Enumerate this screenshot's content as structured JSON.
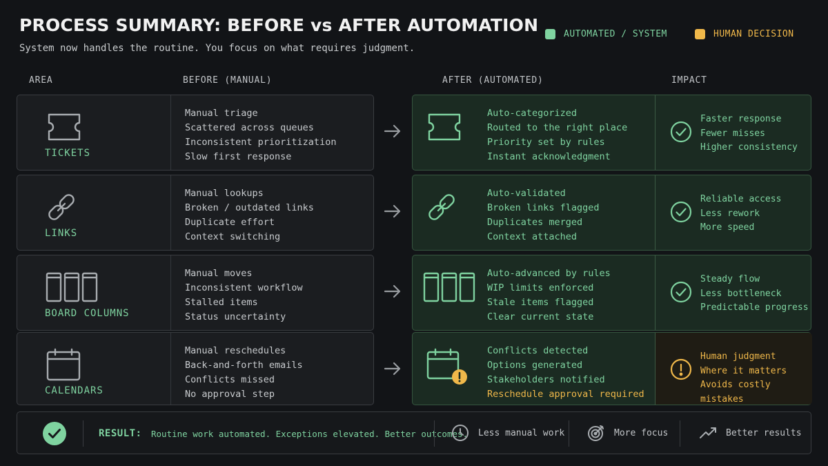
{
  "header": {
    "title": "PROCESS SUMMARY: BEFORE vs AFTER AUTOMATION",
    "subtitle": "System now handles the routine. You focus on what requires judgment."
  },
  "legend": {
    "automated": {
      "label": "AUTOMATED / SYSTEM",
      "color": "#7fd3a0"
    },
    "human": {
      "label": "HUMAN DECISION",
      "color": "#f0b84a"
    }
  },
  "columns": {
    "area": "AREA",
    "before": "BEFORE (MANUAL)",
    "after": "AFTER (AUTOMATED)",
    "impact": "IMPACT"
  },
  "rows": [
    {
      "icon": "ticket-icon",
      "label": "TICKETS",
      "before": [
        "Manual triage",
        "Scattered across queues",
        "Inconsistent prioritization",
        "Slow first response"
      ],
      "after": [
        "Auto-categorized",
        "Routed to the right place",
        "Priority set by rules",
        "Instant acknowledgment"
      ],
      "impact_icon": "check-circle-icon",
      "impact": [
        "Faster response",
        "Fewer misses",
        "Higher consistency"
      ]
    },
    {
      "icon": "link-icon",
      "label": "LINKS",
      "before": [
        "Manual lookups",
        "Broken / outdated links",
        "Duplicate effort",
        "Context switching"
      ],
      "after": [
        "Auto-validated",
        "Broken links flagged",
        "Duplicates merged",
        "Context attached"
      ],
      "impact_icon": "check-circle-icon",
      "impact": [
        "Reliable access",
        "Less rework",
        "More speed"
      ]
    },
    {
      "icon": "board-columns-icon",
      "label": "BOARD COLUMNS",
      "before": [
        "Manual moves",
        "Inconsistent workflow",
        "Stalled items",
        "Status uncertainty"
      ],
      "after": [
        "Auto-advanced by rules",
        "WIP limits enforced",
        "Stale items flagged",
        "Clear current state"
      ],
      "impact_icon": "check-circle-icon",
      "impact": [
        "Steady flow",
        "Less bottleneck",
        "Predictable progress"
      ]
    },
    {
      "icon": "calendar-icon",
      "label": "CALENDARS",
      "before": [
        "Manual reschedules",
        "Back-and-forth emails",
        "Conflicts missed",
        "No approval step"
      ],
      "after": [
        "Conflicts detected",
        "Options generated",
        "Stakeholders notified",
        "Reschedule approval required"
      ],
      "impact_icon": "warning-circle-icon",
      "impact": [
        "Human judgment",
        "Where it matters",
        "Avoids costly mistakes"
      ]
    }
  ],
  "result": {
    "label": "RESULT:",
    "text": "Routine work automated. Exceptions elevated. Better outcomes.",
    "items": [
      {
        "icon": "clock-icon",
        "label": "Less manual work"
      },
      {
        "icon": "target-icon",
        "label": "More focus"
      },
      {
        "icon": "trend-up-icon",
        "label": "Better results"
      }
    ]
  }
}
